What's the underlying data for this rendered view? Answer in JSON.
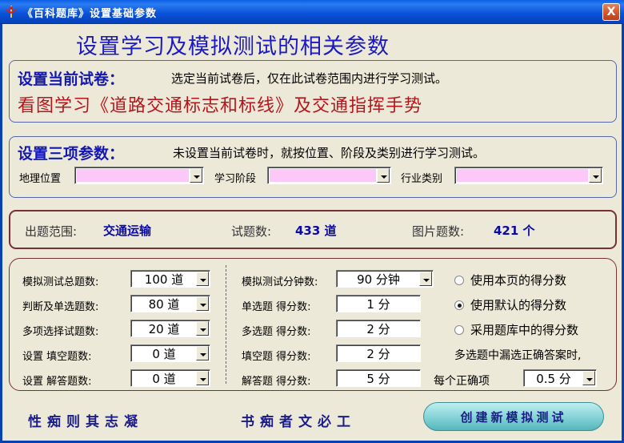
{
  "window": {
    "title": "《百科题库》设置基础参数",
    "close_label": "X"
  },
  "page_title": "设置学习及模拟测试的相关参数",
  "current_paper": {
    "heading": "设置当前试卷：",
    "note": "选定当前试卷后，仅在此试卷范围内进行学习测试。",
    "name": "看图学习《道路交通标志和标线》及交通指挥手势"
  },
  "three_params": {
    "heading": "设置三项参数：",
    "note": "未设置当前试卷时，就按位置、阶段及类别进行学习测试。",
    "location_label": "地理位置",
    "location_value": "",
    "stage_label": "学习阶段",
    "stage_value": "",
    "industry_label": "行业类别",
    "industry_value": ""
  },
  "scope": {
    "range_label": "出题范围:",
    "range_value": "交通运输",
    "count_label": "试题数:",
    "count_value": "433 道",
    "image_label": "图片题数:",
    "image_value": "421 个"
  },
  "settings": {
    "left": [
      {
        "label": "模拟测试总题数:",
        "value": "100 道"
      },
      {
        "label": "判断及单选题数:",
        "value": "80 道"
      },
      {
        "label": "多项选择试题数:",
        "value": "20 道"
      },
      {
        "label": "设置 填空题数:",
        "value": "0 道"
      },
      {
        "label": "设置 解答题数:",
        "value": "0 道"
      }
    ],
    "middle": [
      {
        "label": "模拟测试分钟数:",
        "value": "90 分钟"
      },
      {
        "label": "单选题 得分数:",
        "value": "1 分"
      },
      {
        "label": "多选题 得分数:",
        "value": "2 分"
      },
      {
        "label": "填空题 得分数:",
        "value": "2 分"
      },
      {
        "label": "解答题 得分数:",
        "value": "5 分"
      }
    ],
    "radios": [
      {
        "label": "使用本页的得分数",
        "selected": false
      },
      {
        "label": "使用默认的得分数",
        "selected": true
      },
      {
        "label": "采用题库中的得分数",
        "selected": false
      }
    ],
    "partial_note": "多选题中漏选正确答案时,",
    "per_correct_label": "每个正确项",
    "per_correct_value": "0.5 分"
  },
  "footer": {
    "motto_left": "性痴则其志凝",
    "motto_right": "书痴者文必工",
    "create_button": "创建新模拟测试"
  },
  "colors": {
    "title_blue": "#1c1ac0",
    "paper_red": "#b8141c",
    "pink_field": "#fbc8f7",
    "border_maroon": "#7a2f35"
  }
}
